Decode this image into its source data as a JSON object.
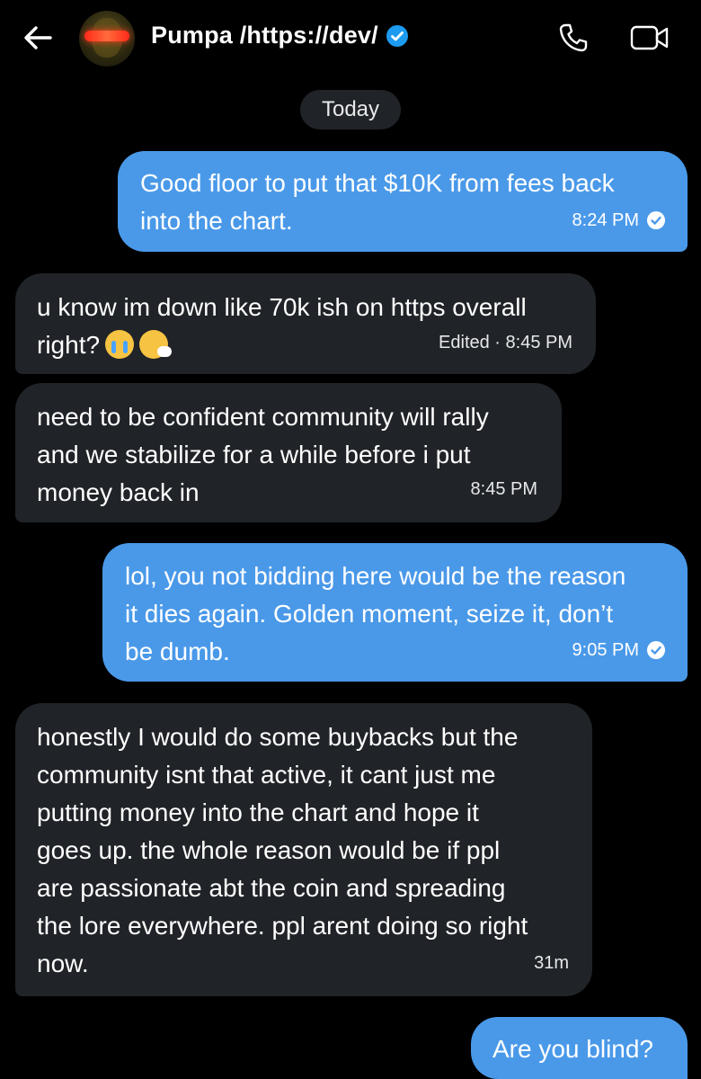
{
  "header": {
    "contact_name": "Pumpa /https://dev/",
    "icons": [
      "back-arrow-icon",
      "verified-badge-icon",
      "phone-icon",
      "video-camera-icon"
    ]
  },
  "date_divider": "Today",
  "messages": [
    {
      "direction": "sent",
      "lines": [
        "Good floor to put that $10K from fees back",
        "into the chart."
      ],
      "time": "8:24 PM",
      "status": "read"
    },
    {
      "direction": "received",
      "lines": [
        "u know im down like 70k ish on https overall",
        "right?"
      ],
      "emojis": [
        "loudly-crying-face",
        "sneezing-face"
      ],
      "time": "Edited · 8:45 PM"
    },
    {
      "direction": "received",
      "lines": [
        "need to be confident community will rally",
        "and we stabilize for a while before i put",
        "money back in"
      ],
      "time": "8:45 PM"
    },
    {
      "direction": "sent",
      "lines": [
        "lol, you not bidding here would be the reason",
        "it dies again. Golden moment, seize it, don’t",
        "be dumb."
      ],
      "time": "9:05 PM",
      "status": "read"
    },
    {
      "direction": "received",
      "lines": [
        "honestly I would do some buybacks but the",
        "community isnt that active, it cant just me",
        "putting money into the chart and hope it",
        "goes up. the whole reason would be if ppl",
        "are passionate abt the coin and spreading",
        "the lore everywhere. ppl arent doing so right",
        "now."
      ],
      "time": "31m"
    },
    {
      "direction": "sent",
      "lines": [
        "Are you blind?"
      ]
    }
  ],
  "colors": {
    "sent_bubble": "#4a99e9",
    "received_bubble": "#202327",
    "background": "#000000",
    "verified": "#1d9bf0"
  }
}
